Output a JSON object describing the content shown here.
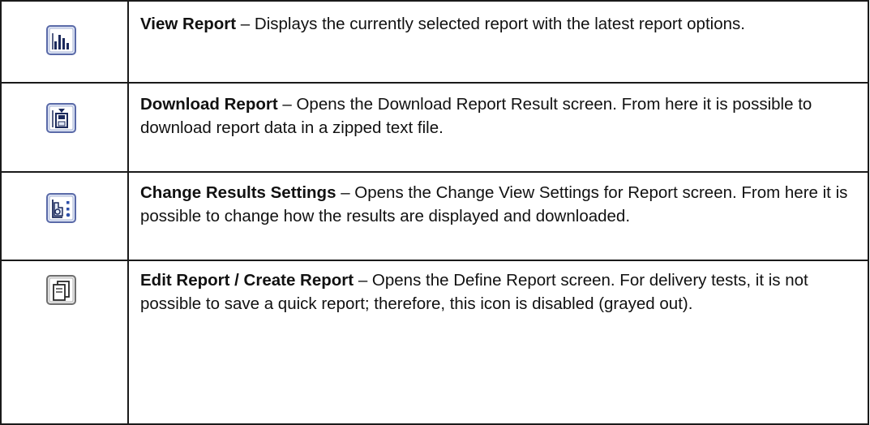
{
  "rows": [
    {
      "icon": "bar-chart-icon",
      "title": "View Report",
      "dash": " – ",
      "text": "Displays the currently selected report with the latest report options."
    },
    {
      "icon": "download-disk-icon",
      "title": "Download Report",
      "dash": " – ",
      "text": "Opens the Download Report Result screen. From here it is possible to download report data in a zipped text file."
    },
    {
      "icon": "settings-shapes-icon",
      "title": "Change Results Settings",
      "dash": " – ",
      "text": "Opens the Change View Settings for Report screen. From here it is possible to change how the results are displayed and downloaded."
    },
    {
      "icon": "copy-pages-icon",
      "title": "Edit Report / Create Report",
      "dash": " – ",
      "text": "Opens the Define Report screen. For delivery tests, it is not possible to save a quick report; therefore, this icon is disabled (grayed out)."
    }
  ],
  "colors": {
    "icon_blue_fill": "#dfe6f5",
    "icon_blue_border": "#5a6aa8",
    "icon_dark": "#1c2a5c",
    "icon_gray_fill": "#e6e6e6",
    "icon_gray_border": "#6f6f6f"
  }
}
